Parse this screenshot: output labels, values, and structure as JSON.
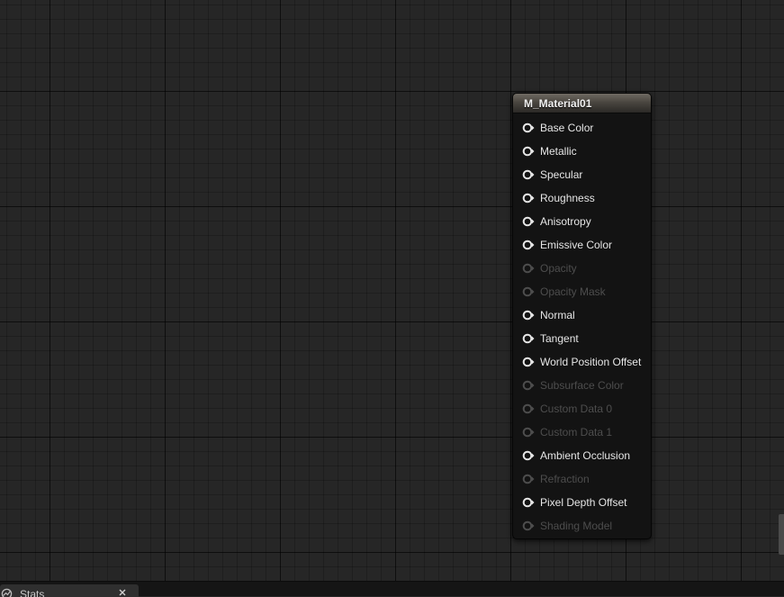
{
  "node": {
    "title": "M_Material01",
    "pins": [
      {
        "label": "Base Color",
        "enabled": true
      },
      {
        "label": "Metallic",
        "enabled": true
      },
      {
        "label": "Specular",
        "enabled": true
      },
      {
        "label": "Roughness",
        "enabled": true
      },
      {
        "label": "Anisotropy",
        "enabled": true
      },
      {
        "label": "Emissive Color",
        "enabled": true
      },
      {
        "label": "Opacity",
        "enabled": false
      },
      {
        "label": "Opacity Mask",
        "enabled": false
      },
      {
        "label": "Normal",
        "enabled": true
      },
      {
        "label": "Tangent",
        "enabled": true
      },
      {
        "label": "World Position Offset",
        "enabled": true
      },
      {
        "label": "Subsurface Color",
        "enabled": false
      },
      {
        "label": "Custom Data 0",
        "enabled": false
      },
      {
        "label": "Custom Data 1",
        "enabled": false
      },
      {
        "label": "Ambient Occlusion",
        "enabled": true
      },
      {
        "label": "Refraction",
        "enabled": false
      },
      {
        "label": "Pixel Depth Offset",
        "enabled": true
      },
      {
        "label": "Shading Model",
        "enabled": false
      }
    ],
    "pin_icon": "input-pin-icon",
    "enabled_pin_color": "#e6e6e6",
    "disabled_pin_color": "#4d4d4d"
  },
  "bottom_panel": {
    "tab_label": "Stats",
    "tab_icon": "stats-icon",
    "close_icon": "close-icon"
  }
}
